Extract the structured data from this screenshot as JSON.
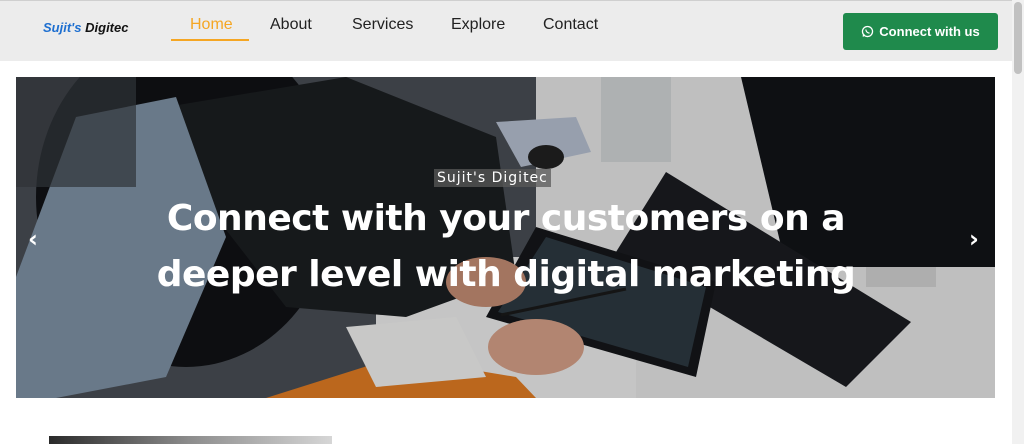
{
  "navbar": {
    "brand_first": "Sujit's",
    "brand_second": "Digitec",
    "links": [
      "Home",
      "About",
      "Services",
      "Explore",
      "Contact"
    ],
    "active_link": "Home",
    "cta_label": "Connect with us",
    "cta_icon": "whatsapp-icon"
  },
  "hero": {
    "eyebrow": "Sujit's Digitec",
    "headline": "Connect with your customers on a deeper level with digital marketing",
    "prev_icon": "chevron-left-icon",
    "next_icon": "chevron-right-icon"
  },
  "colors": {
    "accent": "#f5a623",
    "brand_blue": "#1e6fd0",
    "cta_green": "#1f8a4c",
    "navbar_bg": "#ececec"
  }
}
